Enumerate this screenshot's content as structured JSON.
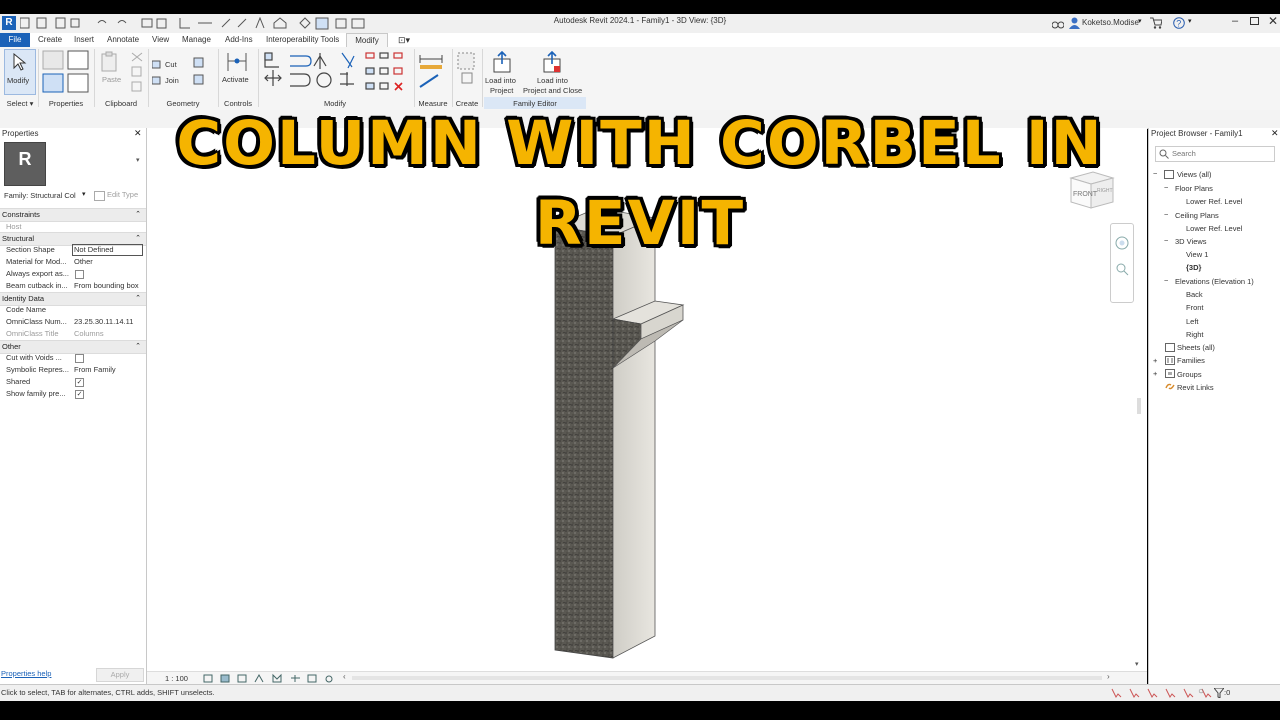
{
  "app": {
    "title": "Autodesk Revit 2024.1 - Family1 - 3D View: {3D}",
    "logo": "R",
    "user": "Koketso.Modise"
  },
  "menu": [
    "File",
    "Create",
    "Insert",
    "Annotate",
    "View",
    "Manage",
    "Add-Ins",
    "Interoperability Tools",
    "Modify"
  ],
  "ribbon": {
    "modify_label": "Modify",
    "select_label": "Select",
    "select_arrow": "▾",
    "properties_label": "Properties",
    "paste_label": "Paste",
    "clipboard_label": "Clipboard",
    "cut_label": "Cut",
    "join_label": "Join",
    "geometry_label": "Geometry",
    "activate_label": "Activate",
    "controls_label": "Controls",
    "modify_panel_label": "Modify",
    "measure_label": "Measure",
    "create_label": "Create",
    "load_into_project": [
      "Load into",
      "Project"
    ],
    "load_into_project_close": [
      "Load into",
      "Project and Close"
    ],
    "family_editor_label": "Family Editor"
  },
  "properties": {
    "header": "Properties",
    "type_selector": "Family: Structural Col",
    "edit_type": "Edit Type",
    "sections": [
      {
        "name": "Constraints",
        "rows": [
          {
            "k": "Host",
            "v": "",
            "gray": true
          }
        ]
      },
      {
        "name": "Structural",
        "rows": [
          {
            "k": "Section Shape",
            "v": "Not Defined",
            "boxed": true
          },
          {
            "k": "Material for Mod...",
            "v": "Other"
          },
          {
            "k": "Always export as...",
            "v": "",
            "check": false
          },
          {
            "k": "Beam cutback in...",
            "v": "From bounding box"
          }
        ]
      },
      {
        "name": "Identity Data",
        "rows": [
          {
            "k": "Code Name",
            "v": ""
          },
          {
            "k": "OmniClass Num...",
            "v": "23.25.30.11.14.11"
          },
          {
            "k": "OmniClass Title",
            "v": "Columns",
            "gray": true
          }
        ]
      },
      {
        "name": "Other",
        "rows": [
          {
            "k": "Cut with Voids ...",
            "v": "",
            "check": false
          },
          {
            "k": "Symbolic Repres...",
            "v": "From Family"
          },
          {
            "k": "Shared",
            "v": "",
            "check": true
          },
          {
            "k": "Show family pre...",
            "v": "",
            "check": true
          }
        ]
      }
    ],
    "help_link": "Properties help",
    "apply": "Apply"
  },
  "view": {
    "overlay_title": "COLUMN WITH CORBEL IN REVIT",
    "viewcube_face": "FRONT",
    "viewcube_side": "RIGHT",
    "scale": "1 : 100"
  },
  "browser": {
    "header": "Project Browser - Family1",
    "search_placeholder": "Search",
    "items": [
      {
        "label": "Views (all)"
      },
      {
        "label": "Floor Plans"
      },
      {
        "label": "Lower Ref. Level"
      },
      {
        "label": "Ceiling Plans"
      },
      {
        "label": "Lower Ref. Level"
      },
      {
        "label": "3D Views"
      },
      {
        "label": "View 1"
      },
      {
        "label": "{3D}"
      },
      {
        "label": "Elevations (Elevation 1)"
      },
      {
        "label": "Back"
      },
      {
        "label": "Front"
      },
      {
        "label": "Left"
      },
      {
        "label": "Right"
      },
      {
        "label": "Sheets (all)"
      },
      {
        "label": "Families"
      },
      {
        "label": "Groups"
      },
      {
        "label": "Revit Links"
      }
    ]
  },
  "status": {
    "text": "Click to select, TAB for alternates, CTRL adds, SHIFT unselects.",
    "filter_count": ":0"
  }
}
